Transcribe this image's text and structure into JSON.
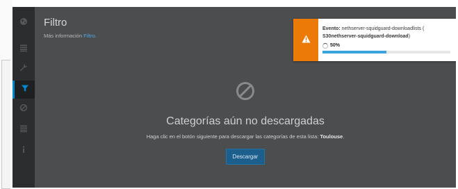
{
  "page": {
    "title": "Filtro",
    "more_info_prefix": "Más información",
    "more_info_link": "Filtro",
    "more_info_suffix": "."
  },
  "sidebar": {
    "items": [
      {
        "icon": "globe-icon",
        "active": false
      },
      {
        "icon": "list-icon",
        "active": false
      },
      {
        "icon": "wrench-icon",
        "active": false
      },
      {
        "icon": "filter-icon",
        "active": true
      },
      {
        "icon": "ban-icon",
        "active": false
      },
      {
        "icon": "list-icon",
        "active": false
      },
      {
        "icon": "info-icon",
        "active": false
      }
    ]
  },
  "empty_state": {
    "icon": "ban-icon",
    "title": "Categorías aún no descargadas",
    "description": "Haga clic en el botón siguiente para descargar las categorías de esta lista:",
    "list_name": "Toulouse",
    "button_label": "Descargar"
  },
  "notification": {
    "event_label": "Evento:",
    "event_name": "nethserver-squidguard-downloadlists (",
    "task": "S30nethserver-squidguard-download",
    "task_suffix": ")",
    "progress_text": "50%",
    "progress": 0.5,
    "accent_color": "#ec7a08"
  }
}
